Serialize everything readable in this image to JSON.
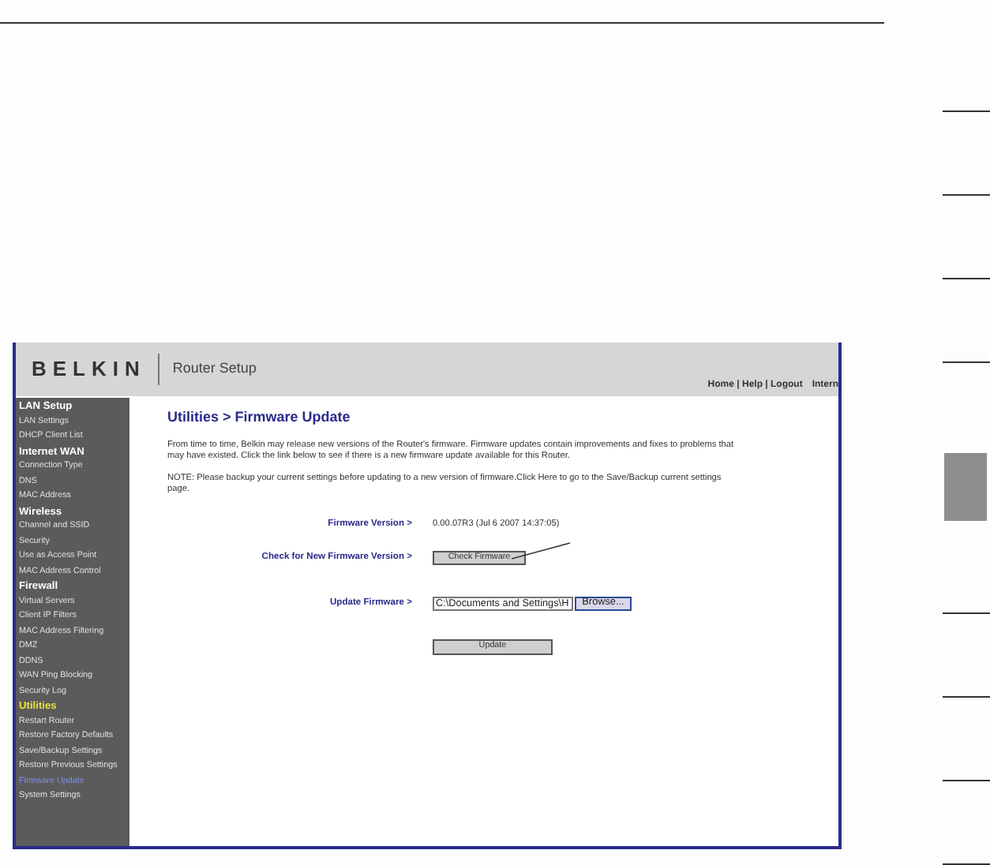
{
  "router_screen": {
    "logo": "BELKIN",
    "app_title": "Router Setup",
    "top_links": [
      "Home | Help | Logout",
      "Intern"
    ],
    "sidebar": [
      {
        "kind": "heading",
        "label": "LAN Setup",
        "selected": false
      },
      {
        "kind": "link",
        "label": "LAN Settings",
        "selected": false
      },
      {
        "kind": "link",
        "label": "DHCP Client List",
        "selected": false
      },
      {
        "kind": "heading",
        "label": "Internet WAN",
        "selected": false
      },
      {
        "kind": "link",
        "label": "Connection Type",
        "selected": false
      },
      {
        "kind": "link",
        "label": "DNS",
        "selected": false
      },
      {
        "kind": "link",
        "label": "MAC Address",
        "selected": false
      },
      {
        "kind": "heading",
        "label": "Wireless",
        "selected": false
      },
      {
        "kind": "link",
        "label": "Channel and SSID",
        "selected": false
      },
      {
        "kind": "link",
        "label": "Security",
        "selected": false
      },
      {
        "kind": "link",
        "label": "Use as Access Point",
        "selected": false
      },
      {
        "kind": "link",
        "label": "MAC Address Control",
        "selected": false
      },
      {
        "kind": "heading",
        "label": "Firewall",
        "selected": false
      },
      {
        "kind": "link",
        "label": "Virtual Servers",
        "selected": false
      },
      {
        "kind": "link",
        "label": "Client IP Filters",
        "selected": false
      },
      {
        "kind": "link",
        "label": "MAC Address Filtering",
        "selected": false
      },
      {
        "kind": "link",
        "label": "DMZ",
        "selected": false
      },
      {
        "kind": "link",
        "label": "DDNS",
        "selected": false
      },
      {
        "kind": "link",
        "label": "WAN Ping Blocking",
        "selected": false
      },
      {
        "kind": "link",
        "label": "Security Log",
        "selected": false
      },
      {
        "kind": "heading",
        "label": "Utilities",
        "selected": true
      },
      {
        "kind": "link",
        "label": "Restart Router",
        "selected": false
      },
      {
        "kind": "link",
        "label": "Restore Factory Defaults",
        "selected": false
      },
      {
        "kind": "link",
        "label": "Save/Backup Settings",
        "selected": false
      },
      {
        "kind": "link",
        "label": "Restore Previous Settings",
        "selected": false
      },
      {
        "kind": "link",
        "label": "Firmware Update",
        "selected": true
      },
      {
        "kind": "link",
        "label": "System Settings",
        "selected": false
      }
    ],
    "page_title": "Utilities > Firmware Update",
    "intro": "From time to time, Belkin may release new versions of the Router's firmware. Firmware updates contain improvements and fixes to problems that may have existed. Click the link below to see if there is a new firmware update available for this Router.",
    "note": "NOTE: Please backup your current settings before updating to a new version of firmware.Click Here to go to the Save/Backup current settings page.",
    "firmware_version": {
      "label": "Firmware Version >",
      "value": "0.00.07R3 (Jul 6 2007 14:37:05)"
    },
    "check": {
      "label": "Check for New Firmware Version >",
      "button": "Check Firmware"
    },
    "update_firmware": {
      "label": "Update Firmware >",
      "value": "C:\\Documents and Settings\\H",
      "browse": "Browse..."
    },
    "update_button": "Update"
  },
  "chapter_tabs": [
    {
      "selected": false
    },
    {
      "selected": false
    },
    {
      "selected": false
    },
    {
      "selected": false
    },
    {
      "selected": true
    },
    {
      "selected": false
    },
    {
      "selected": false
    },
    {
      "selected": false
    },
    {
      "selected": false
    }
  ]
}
